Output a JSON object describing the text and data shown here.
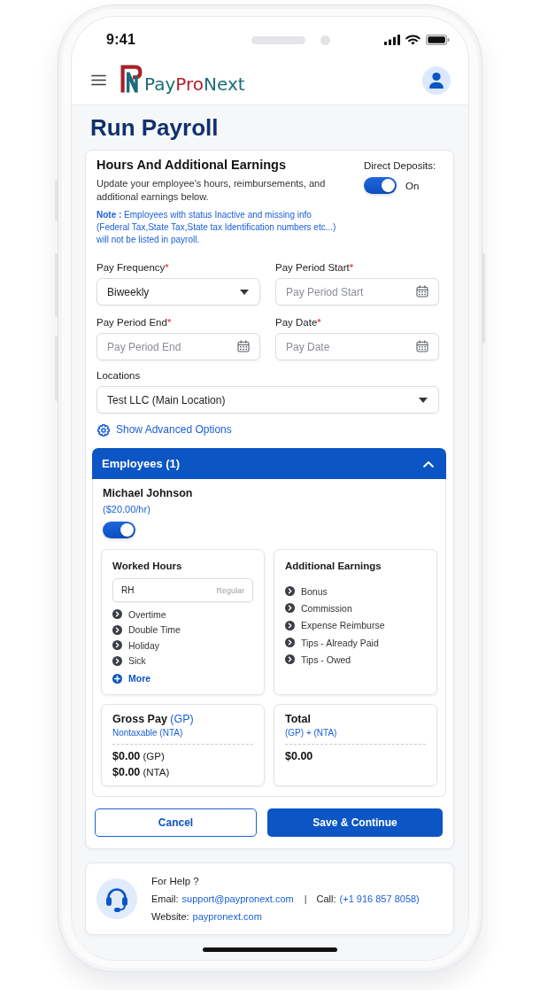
{
  "status_bar": {
    "time": "9:41"
  },
  "header": {
    "logo": {
      "wordmark": [
        {
          "text": "Pay",
          "color": "#1d6a7a"
        },
        {
          "text": "Pro",
          "color": "#b1202b"
        },
        {
          "text": "Next",
          "color": "#1d6a7a"
        }
      ]
    }
  },
  "page_title": "Run Payroll",
  "earnings_card": {
    "title": "Hours And Additional Earnings",
    "description": "Update your employee's hours, reimbursements, and additional earnings below.",
    "note": "**Note :** Employees with status Inactive and missing info (Federal Tax,State Tax,State tax Identification numbers etc...) will not be listed in payroll.",
    "direct_deposits": {
      "label": "Direct Deposits:",
      "on": true,
      "state_label": "On"
    },
    "fields": [
      {
        "kind": "select",
        "label": "Pay Frequency",
        "required_mark": "*",
        "value": "Biweekly"
      },
      {
        "kind": "date",
        "label": "Pay Period Start",
        "required_mark": "*",
        "placeholder": "Pay Period Start"
      },
      {
        "kind": "date",
        "label": "Pay Period End",
        "required_mark": "*",
        "placeholder": "Pay Period End"
      },
      {
        "kind": "date",
        "label": "Pay Date",
        "required_mark": "*",
        "placeholder": "Pay Date"
      }
    ],
    "location_field": {
      "kind": "select",
      "label": "Locations",
      "value": "Test LLC (Main Location)"
    },
    "advanced_options": {
      "label": "Show Advanced Options"
    },
    "employees_panel": {
      "title": "Employees (1)",
      "expanded": true,
      "employees": [
        {
          "name": "Michael Johnson",
          "rate": "($20.00/hr)",
          "included": true,
          "worked_hours": {
            "title": "Worked Hours",
            "regular_field": {
              "prefix": "RH",
              "placeholder": "Regular"
            },
            "options": [
              "Overtime",
              "Double Time",
              "Holiday",
              "Sick"
            ],
            "more": "More"
          },
          "additional_earnings": {
            "title": "Additional Earnings",
            "options": [
              "Bonus",
              "Commission",
              "Expense Reimburse",
              "Tips - Already Paid",
              "Tips - Owed"
            ]
          },
          "gross_pay": {
            "title": "**Gross Pay** (GP)",
            "subtitle": "Nontaxable (NTA)",
            "amounts": [
              "**$0.00** (GP)",
              "**$0.00** (NTA)"
            ]
          },
          "total": {
            "title": "Total",
            "subtitle": "(GP) + (NTA)",
            "amount": "$0.00"
          }
        }
      ]
    },
    "actions": [
      {
        "label": "Cancel",
        "kind": "secondary"
      },
      {
        "label": "Save & Continue",
        "kind": "primary"
      }
    ]
  },
  "help": {
    "title": "For Help ?",
    "separator": "|",
    "contact_rows": [
      {
        "items": [
          {
            "label": "Email:",
            "value": "support@paypronext.com"
          },
          {
            "label": "Call:",
            "value": "(+1 916 857 8058)"
          }
        ]
      },
      {
        "items": [
          {
            "label": "Website:",
            "value": "paypronext.com"
          }
        ]
      }
    ]
  }
}
